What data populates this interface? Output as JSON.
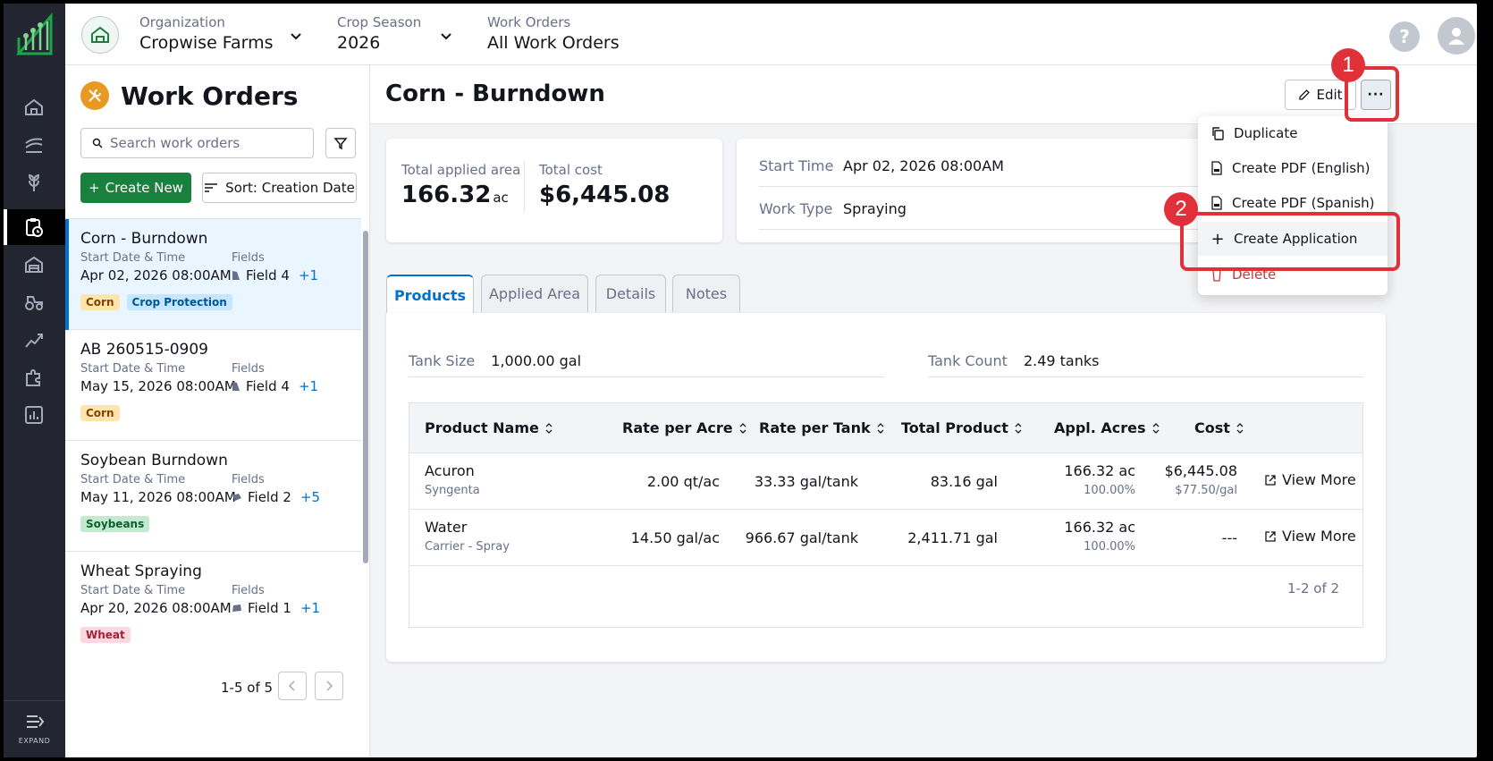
{
  "topbar": {
    "organization_label": "Organization",
    "organization_value": "Cropwise Farms",
    "season_label": "Crop Season",
    "season_value": "2026",
    "workorders_label": "Work Orders",
    "workorders_value": "All Work Orders",
    "help_glyph": "?"
  },
  "rail": {
    "icons": [
      "home-icon",
      "field-icon",
      "crop-icon",
      "work-orders-icon",
      "warehouse-icon",
      "tractor-icon",
      "analytics-icon",
      "integrations-icon",
      "reports-icon"
    ],
    "expand_label": "EXPAND"
  },
  "list": {
    "title": "Work Orders",
    "search_placeholder": "Search work orders",
    "create_label": "Create New",
    "sort_label": "Sort: Creation Date",
    "start_label": "Start Date & Time",
    "fields_label": "Fields",
    "items": [
      {
        "name": "Corn - Burndown",
        "date": "Apr 02, 2026 08:00AM",
        "field": "Field 4",
        "more": "+1",
        "tags": [
          "Corn",
          "Crop Protection"
        ]
      },
      {
        "name": "AB 260515-0909",
        "date": "May 15, 2026 08:00AM",
        "field": "Field 4",
        "more": "+1",
        "tags": [
          "Corn"
        ]
      },
      {
        "name": "Soybean Burndown",
        "date": "May 11, 2026 08:00AM",
        "field": "Field 2",
        "more": "+5",
        "tags": [
          "Soybeans"
        ]
      },
      {
        "name": "Wheat Spraying",
        "date": "Apr 20, 2026 08:00AM",
        "field": "Field 1",
        "more": "+1",
        "tags": [
          "Wheat"
        ]
      }
    ],
    "pager_text": "1-5 of 5"
  },
  "detail": {
    "title": "Corn - Burndown",
    "edit_label": "Edit",
    "more_glyph": "···",
    "applied_area_label": "Total applied area",
    "applied_area_value": "166.32",
    "applied_area_unit": "ac",
    "total_cost_label": "Total cost",
    "total_cost_value": "$6,445.08",
    "start_time_label": "Start Time",
    "start_time_value": "Apr 02, 2026 08:00AM",
    "work_type_label": "Work Type",
    "work_type_value": "Spraying",
    "tabs": [
      "Products",
      "Applied Area",
      "Details",
      "Notes"
    ],
    "tank_size_label": "Tank Size",
    "tank_size_value": "1,000.00 gal",
    "tank_count_label": "Tank Count",
    "tank_count_value": "2.49 tanks",
    "columns": [
      "Product Name",
      "Rate per Acre",
      "Rate per Tank",
      "Total Product",
      "Appl. Acres",
      "Cost"
    ],
    "products": [
      {
        "name": "Acuron",
        "maker": "Syngenta",
        "rate_acre": "2.00 qt/ac",
        "rate_tank": "33.33 gal/tank",
        "total": "83.16 gal",
        "acres": "166.32 ac",
        "acres_pct": "100.00%",
        "cost": "$6,445.08",
        "cost_unit": "$77.50/gal",
        "action": "View More"
      },
      {
        "name": "Water",
        "maker": "Carrier - Spray",
        "rate_acre": "14.50 gal/ac",
        "rate_tank": "966.67 gal/tank",
        "total": "2,411.71 gal",
        "acres": "166.32 ac",
        "acres_pct": "100.00%",
        "cost": "---",
        "cost_unit": "",
        "action": "View More"
      }
    ],
    "table_count": "1-2 of 2"
  },
  "menu": {
    "items": [
      "Duplicate",
      "Create PDF (English)",
      "Create PDF (Spanish)",
      "Create Application",
      "Delete"
    ]
  },
  "annotations": {
    "step1": "1",
    "step2": "2"
  },
  "colors": {
    "primary_green": "#19803d",
    "primary_blue": "#0071cd",
    "danger_red": "#cf3537",
    "annotation_red": "#e0313a",
    "rail_bg": "#232630"
  }
}
